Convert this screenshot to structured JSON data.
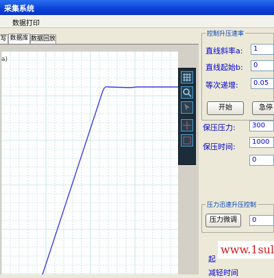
{
  "window": {
    "title": "采集系统"
  },
  "menu": {
    "item": "数据打印"
  },
  "tabs": [
    {
      "label": "写"
    },
    {
      "label": "数据库"
    },
    {
      "label": "数据回放"
    }
  ],
  "chart": {
    "corner_label": "a)"
  },
  "rate_group": {
    "title": "控制升压速率",
    "slope_label": "直线斜率a:",
    "slope_value": "1",
    "intercept_label": "直线起始b:",
    "intercept_value": "0",
    "step_label": "等次递增:",
    "step_value": "0.05",
    "start_button": "开始",
    "stop_button": "急停"
  },
  "hold": {
    "pressure_label": "保压压力:",
    "pressure_value": "300",
    "time_label": "保压时间:",
    "time_value": "1000",
    "extra_value": "0"
  },
  "fast_group": {
    "title": "压力迅速升压控制",
    "button": "压力微调",
    "value": "0"
  },
  "bottom": {
    "label1": "起",
    "label2": "减轻时间"
  },
  "watermark": "www.1sul",
  "colors": {
    "curve": "#3a3ae0",
    "grid": "#9fd3d3",
    "title_bar": "#0a3fd6"
  }
}
